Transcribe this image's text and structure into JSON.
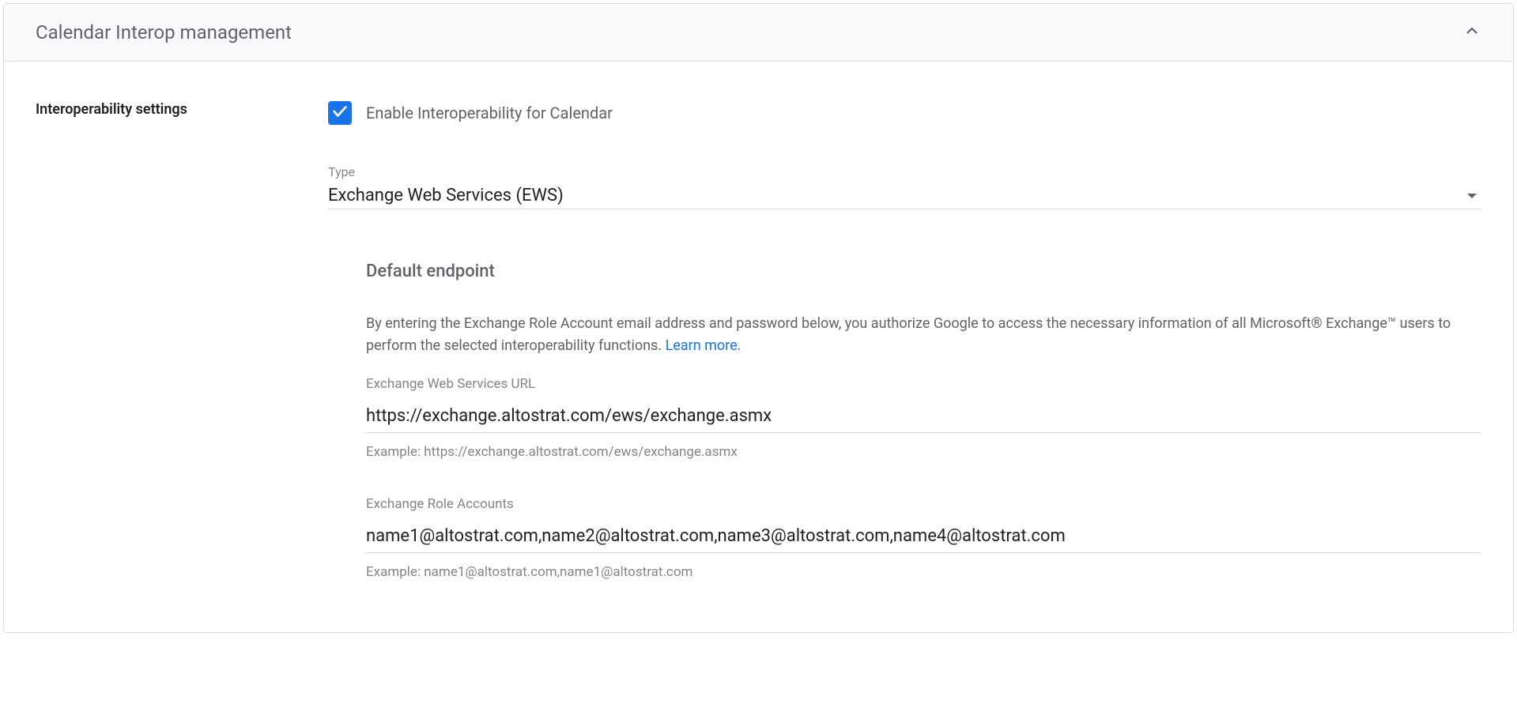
{
  "panel": {
    "title": "Calendar Interop management"
  },
  "section": {
    "title": "Interoperability settings"
  },
  "checkbox": {
    "label": "Enable Interoperability for Calendar"
  },
  "type_field": {
    "label": "Type",
    "value": "Exchange Web Services (EWS)"
  },
  "endpoint": {
    "title": "Default endpoint",
    "description": "By entering the Exchange Role Account email address and password below, you authorize Google to access the necessary information of all Microsoft® Exchange™ users to perform the selected interoperability functions. ",
    "learn_more": "Learn more"
  },
  "ews_url": {
    "label": "Exchange Web Services URL",
    "value": "https://exchange.altostrat.com/ews/exchange.asmx",
    "example": "Example: https://exchange.altostrat.com/ews/exchange.asmx"
  },
  "role_accounts": {
    "label": "Exchange Role Accounts",
    "value": "name1@altostrat.com,name2@altostrat.com,name3@altostrat.com,name4@altostrat.com",
    "example": "Example: name1@altostrat.com,name1@altostrat.com"
  }
}
